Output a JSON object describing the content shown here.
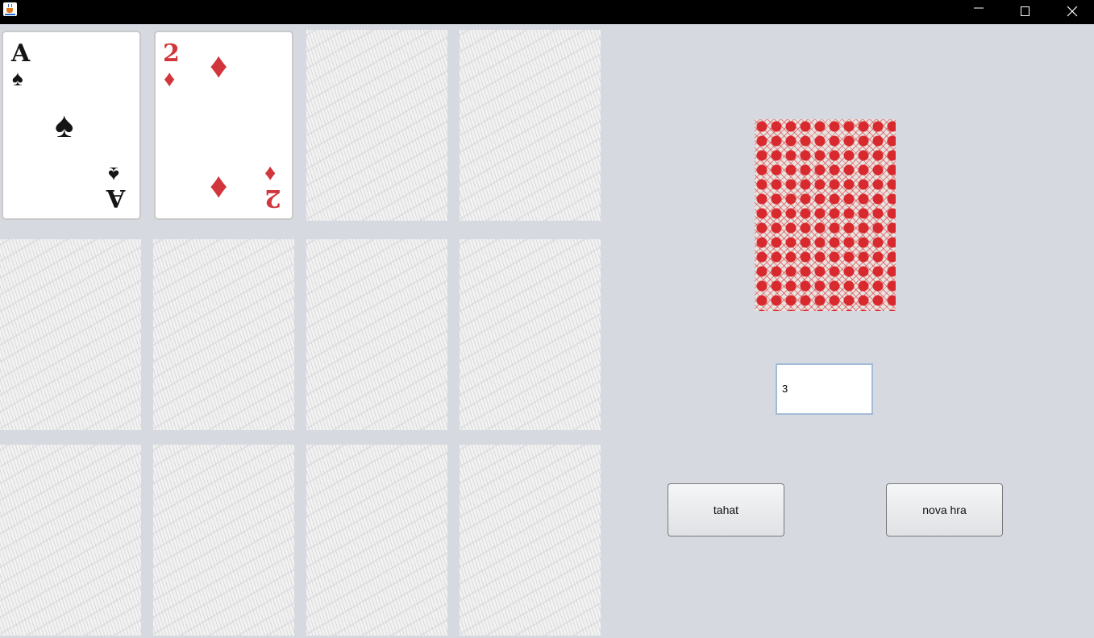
{
  "window": {
    "app_icon": "java-coffee-cup-icon",
    "controls": [
      "minimize-icon",
      "maximize-icon",
      "close-icon"
    ]
  },
  "cards": [
    {
      "state": "face-up",
      "rank": "A",
      "suit": "spade",
      "suit_symbol": "♠",
      "color": "#151515"
    },
    {
      "state": "face-up",
      "rank": "2",
      "suit": "diamond",
      "suit_symbol": "♦",
      "color": "#d0363b"
    },
    {
      "state": "face-down"
    },
    {
      "state": "face-down"
    },
    {
      "state": "face-down"
    },
    {
      "state": "face-down"
    },
    {
      "state": "face-down"
    },
    {
      "state": "face-down"
    },
    {
      "state": "face-down"
    },
    {
      "state": "face-down"
    },
    {
      "state": "face-down"
    },
    {
      "state": "face-down"
    }
  ],
  "deck": {
    "pattern_color": "#d82a2e"
  },
  "count_field": {
    "value": "3"
  },
  "buttons": {
    "draw_label": "tahat",
    "new_game_label": "nova hra"
  }
}
